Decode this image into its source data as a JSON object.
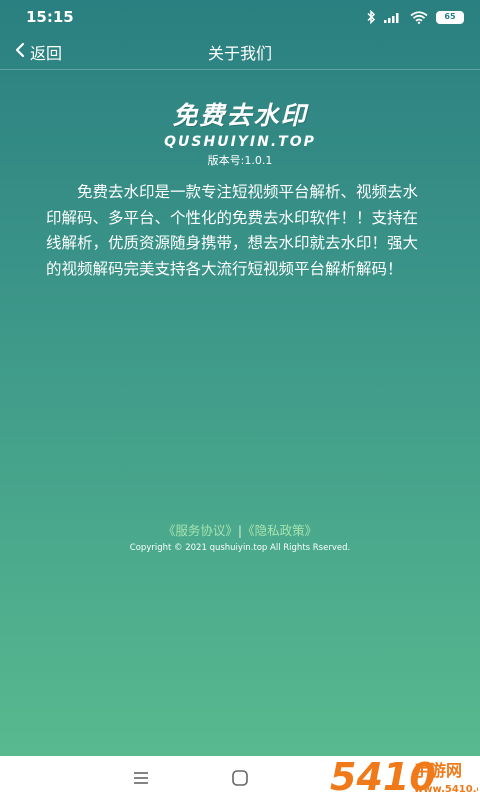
{
  "status_bar": {
    "time": "15:15",
    "battery": "65",
    "icons": [
      "bluetooth-icon",
      "signal-icon",
      "wifi-icon",
      "battery-icon"
    ]
  },
  "nav": {
    "back_label": "返回",
    "title": "关于我们"
  },
  "logo": {
    "main": "免费去水印",
    "sub": "QUSHUIYIN.TOP",
    "version": "版本号:1.0.1"
  },
  "description": "免费去水印是一款专注短视频平台解析、视频去水印解码、多平台、个性化的免费去水印软件！！支持在线解析，优质资源随身携带，想去水印就去水印！强大的视频解码完美支持各大流行短视频平台解析解码！",
  "footer": {
    "service_link": "《服务协议》",
    "separator": "|",
    "privacy_link": "《隐私政策》",
    "copyright": "Copyright © 2021 qushuiyin.top All Rights Rserved."
  },
  "watermark": {
    "number": "5410",
    "text": "手游网",
    "domain": "www.5410.cn"
  },
  "colors": {
    "gradient_top": "#2a7f80",
    "gradient_bottom": "#58b98f",
    "link": "#a6e3b0",
    "watermark_orange": "#f07a1a"
  }
}
